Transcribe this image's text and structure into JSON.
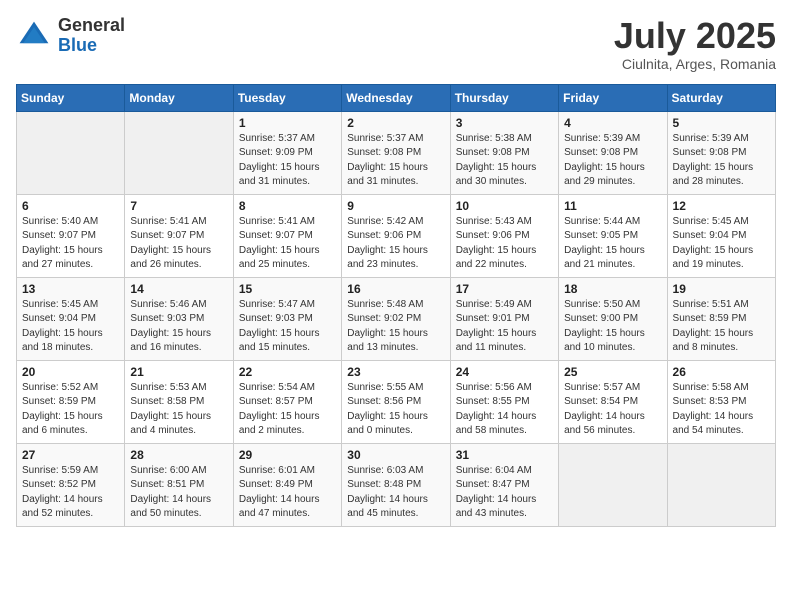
{
  "logo": {
    "general": "General",
    "blue": "Blue"
  },
  "title": "July 2025",
  "location": "Ciulnita, Arges, Romania",
  "days_of_week": [
    "Sunday",
    "Monday",
    "Tuesday",
    "Wednesday",
    "Thursday",
    "Friday",
    "Saturday"
  ],
  "weeks": [
    [
      {
        "day": "",
        "info": ""
      },
      {
        "day": "",
        "info": ""
      },
      {
        "day": "1",
        "info": "Sunrise: 5:37 AM\nSunset: 9:09 PM\nDaylight: 15 hours and 31 minutes."
      },
      {
        "day": "2",
        "info": "Sunrise: 5:37 AM\nSunset: 9:08 PM\nDaylight: 15 hours and 31 minutes."
      },
      {
        "day": "3",
        "info": "Sunrise: 5:38 AM\nSunset: 9:08 PM\nDaylight: 15 hours and 30 minutes."
      },
      {
        "day": "4",
        "info": "Sunrise: 5:39 AM\nSunset: 9:08 PM\nDaylight: 15 hours and 29 minutes."
      },
      {
        "day": "5",
        "info": "Sunrise: 5:39 AM\nSunset: 9:08 PM\nDaylight: 15 hours and 28 minutes."
      }
    ],
    [
      {
        "day": "6",
        "info": "Sunrise: 5:40 AM\nSunset: 9:07 PM\nDaylight: 15 hours and 27 minutes."
      },
      {
        "day": "7",
        "info": "Sunrise: 5:41 AM\nSunset: 9:07 PM\nDaylight: 15 hours and 26 minutes."
      },
      {
        "day": "8",
        "info": "Sunrise: 5:41 AM\nSunset: 9:07 PM\nDaylight: 15 hours and 25 minutes."
      },
      {
        "day": "9",
        "info": "Sunrise: 5:42 AM\nSunset: 9:06 PM\nDaylight: 15 hours and 23 minutes."
      },
      {
        "day": "10",
        "info": "Sunrise: 5:43 AM\nSunset: 9:06 PM\nDaylight: 15 hours and 22 minutes."
      },
      {
        "day": "11",
        "info": "Sunrise: 5:44 AM\nSunset: 9:05 PM\nDaylight: 15 hours and 21 minutes."
      },
      {
        "day": "12",
        "info": "Sunrise: 5:45 AM\nSunset: 9:04 PM\nDaylight: 15 hours and 19 minutes."
      }
    ],
    [
      {
        "day": "13",
        "info": "Sunrise: 5:45 AM\nSunset: 9:04 PM\nDaylight: 15 hours and 18 minutes."
      },
      {
        "day": "14",
        "info": "Sunrise: 5:46 AM\nSunset: 9:03 PM\nDaylight: 15 hours and 16 minutes."
      },
      {
        "day": "15",
        "info": "Sunrise: 5:47 AM\nSunset: 9:03 PM\nDaylight: 15 hours and 15 minutes."
      },
      {
        "day": "16",
        "info": "Sunrise: 5:48 AM\nSunset: 9:02 PM\nDaylight: 15 hours and 13 minutes."
      },
      {
        "day": "17",
        "info": "Sunrise: 5:49 AM\nSunset: 9:01 PM\nDaylight: 15 hours and 11 minutes."
      },
      {
        "day": "18",
        "info": "Sunrise: 5:50 AM\nSunset: 9:00 PM\nDaylight: 15 hours and 10 minutes."
      },
      {
        "day": "19",
        "info": "Sunrise: 5:51 AM\nSunset: 8:59 PM\nDaylight: 15 hours and 8 minutes."
      }
    ],
    [
      {
        "day": "20",
        "info": "Sunrise: 5:52 AM\nSunset: 8:59 PM\nDaylight: 15 hours and 6 minutes."
      },
      {
        "day": "21",
        "info": "Sunrise: 5:53 AM\nSunset: 8:58 PM\nDaylight: 15 hours and 4 minutes."
      },
      {
        "day": "22",
        "info": "Sunrise: 5:54 AM\nSunset: 8:57 PM\nDaylight: 15 hours and 2 minutes."
      },
      {
        "day": "23",
        "info": "Sunrise: 5:55 AM\nSunset: 8:56 PM\nDaylight: 15 hours and 0 minutes."
      },
      {
        "day": "24",
        "info": "Sunrise: 5:56 AM\nSunset: 8:55 PM\nDaylight: 14 hours and 58 minutes."
      },
      {
        "day": "25",
        "info": "Sunrise: 5:57 AM\nSunset: 8:54 PM\nDaylight: 14 hours and 56 minutes."
      },
      {
        "day": "26",
        "info": "Sunrise: 5:58 AM\nSunset: 8:53 PM\nDaylight: 14 hours and 54 minutes."
      }
    ],
    [
      {
        "day": "27",
        "info": "Sunrise: 5:59 AM\nSunset: 8:52 PM\nDaylight: 14 hours and 52 minutes."
      },
      {
        "day": "28",
        "info": "Sunrise: 6:00 AM\nSunset: 8:51 PM\nDaylight: 14 hours and 50 minutes."
      },
      {
        "day": "29",
        "info": "Sunrise: 6:01 AM\nSunset: 8:49 PM\nDaylight: 14 hours and 47 minutes."
      },
      {
        "day": "30",
        "info": "Sunrise: 6:03 AM\nSunset: 8:48 PM\nDaylight: 14 hours and 45 minutes."
      },
      {
        "day": "31",
        "info": "Sunrise: 6:04 AM\nSunset: 8:47 PM\nDaylight: 14 hours and 43 minutes."
      },
      {
        "day": "",
        "info": ""
      },
      {
        "day": "",
        "info": ""
      }
    ]
  ]
}
